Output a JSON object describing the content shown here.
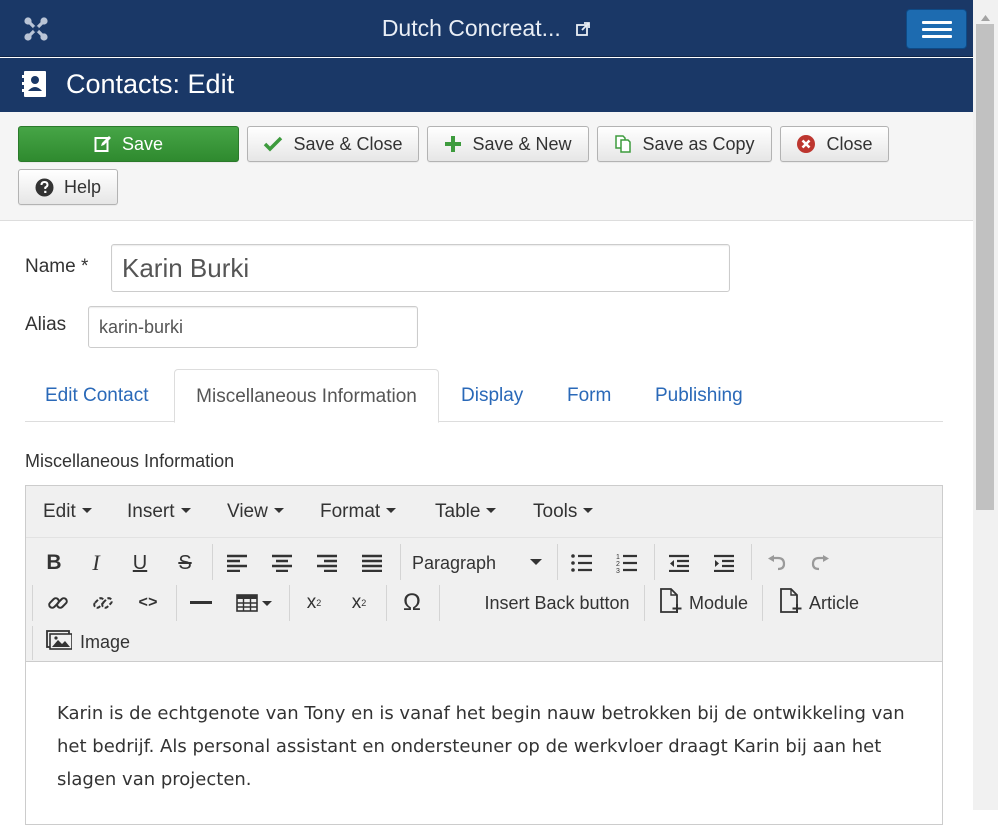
{
  "header": {
    "site_title": "Dutch Concreat...",
    "page_title": "Contacts: Edit",
    "brand_color": "#1a3867",
    "menu_button_color": "#1d6bb0"
  },
  "toolbar": {
    "save": "Save",
    "save_close": "Save & Close",
    "save_new": "Save & New",
    "save_copy": "Save as Copy",
    "close": "Close",
    "help": "Help",
    "save_color": "#3d9b3d",
    "close_icon_color": "#bd362f"
  },
  "form": {
    "name_label": "Name *",
    "name_value": "Karin Burki",
    "alias_label": "Alias",
    "alias_value": "karin-burki"
  },
  "tabs": [
    {
      "label": "Edit Contact",
      "active": false
    },
    {
      "label": "Miscellaneous Information",
      "active": true
    },
    {
      "label": "Display",
      "active": false
    },
    {
      "label": "Form",
      "active": false
    },
    {
      "label": "Publishing",
      "active": false
    }
  ],
  "editor": {
    "section_label": "Miscellaneous Information",
    "menus": [
      "Edit",
      "Insert",
      "View",
      "Format",
      "Table",
      "Tools"
    ],
    "format_select": "Paragraph",
    "buttons": {
      "insert_back": "Insert Back button",
      "module": "Module",
      "article": "Article",
      "image": "Image"
    },
    "content": "Karin is de echtgenote van Tony en is vanaf het begin nauw betrokken bij de ontwikkeling van het bedrijf. Als personal assistant en ondersteuner op de werkvloer draagt Karin bij aan het slagen van projecten."
  },
  "icons": [
    "joomla-logo-icon",
    "external-link-icon",
    "hamburger-menu-icon",
    "address-book-icon",
    "edit-icon",
    "check-icon",
    "plus-icon",
    "copy-icon",
    "close-circle-icon",
    "question-circle-icon"
  ]
}
